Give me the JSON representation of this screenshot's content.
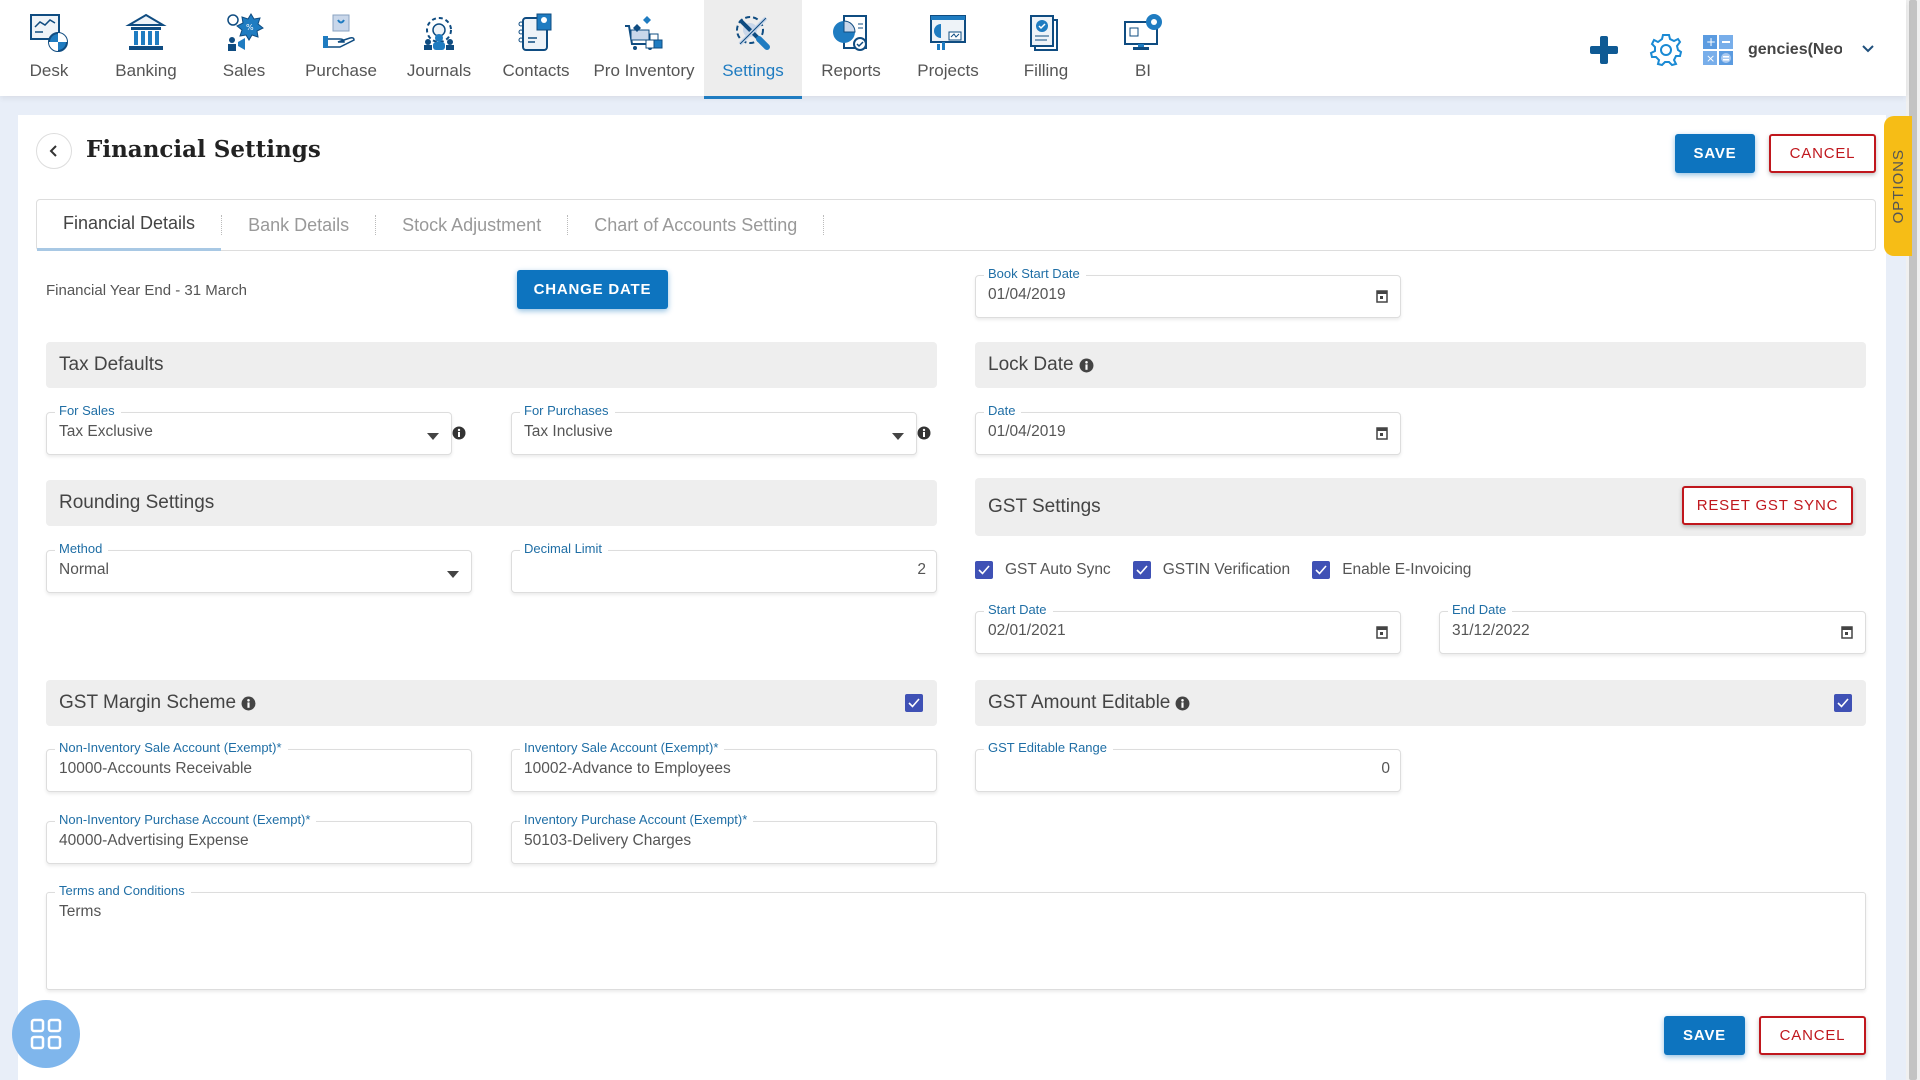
{
  "nav": {
    "items": [
      {
        "label": "Desk",
        "icon": "desk-icon",
        "active": false
      },
      {
        "label": "Banking",
        "icon": "bank-icon",
        "active": false
      },
      {
        "label": "Sales",
        "icon": "sales-icon",
        "active": false
      },
      {
        "label": "Purchase",
        "icon": "purchase-icon",
        "active": false
      },
      {
        "label": "Journals",
        "icon": "journals-icon",
        "active": false
      },
      {
        "label": "Contacts",
        "icon": "contacts-icon",
        "active": false
      },
      {
        "label": "Pro Inventory",
        "icon": "inventory-icon",
        "active": false
      },
      {
        "label": "Settings",
        "icon": "settings-icon",
        "active": true
      },
      {
        "label": "Reports",
        "icon": "reports-icon",
        "active": false
      },
      {
        "label": "Projects",
        "icon": "projects-icon",
        "active": false
      },
      {
        "label": "Filling",
        "icon": "filling-icon",
        "active": false
      },
      {
        "label": "BI",
        "icon": "bi-icon",
        "active": false
      }
    ],
    "company_name": "gencies(Neo l"
  },
  "page": {
    "title": "Financial Settings",
    "save_label": "SAVE",
    "cancel_label": "CANCEL",
    "options_label": "OPTIONS"
  },
  "tabs": [
    {
      "label": "Financial Details",
      "active": true
    },
    {
      "label": "Bank Details",
      "active": false
    },
    {
      "label": "Stock Adjustment",
      "active": false
    },
    {
      "label": "Chart of Accounts Setting",
      "active": false
    }
  ],
  "financial": {
    "year_end_text": "Financial Year End - 31 March",
    "change_date_label": "CHANGE DATE",
    "book_start_label": "Book Start Date",
    "book_start_value": "01/04/2019"
  },
  "tax_defaults": {
    "title": "Tax Defaults",
    "for_sales_label": "For Sales",
    "for_sales_value": "Tax Exclusive",
    "for_purchases_label": "For Purchases",
    "for_purchases_value": "Tax Inclusive"
  },
  "lock_date": {
    "title": "Lock Date",
    "date_label": "Date",
    "date_value": "01/04/2019"
  },
  "rounding": {
    "title": "Rounding Settings",
    "method_label": "Method",
    "method_value": "Normal",
    "decimal_label": "Decimal Limit",
    "decimal_value": "2"
  },
  "gst_settings": {
    "title": "GST Settings",
    "reset_label": "RESET GST SYNC",
    "checkboxes": [
      {
        "label": "GST Auto Sync",
        "checked": true
      },
      {
        "label": "GSTIN Verification",
        "checked": true
      },
      {
        "label": "Enable E-Invoicing",
        "checked": true
      }
    ],
    "start_date_label": "Start Date",
    "start_date_value": "02/01/2021",
    "end_date_label": "End Date",
    "end_date_value": "31/12/2022"
  },
  "gst_margin": {
    "title": "GST Margin Scheme",
    "checked": true,
    "non_inv_sale_label": "Non-Inventory Sale Account (Exempt)*",
    "non_inv_sale_value": "10000-Accounts Receivable",
    "inv_sale_label": "Inventory Sale Account (Exempt)*",
    "inv_sale_value": "10002-Advance to Employees",
    "non_inv_purchase_label": "Non-Inventory Purchase Account (Exempt)*",
    "non_inv_purchase_value": "40000-Advertising Expense",
    "inv_purchase_label": "Inventory Purchase Account (Exempt)*",
    "inv_purchase_value": "50103-Delivery Charges"
  },
  "gst_amount": {
    "title": "GST Amount Editable",
    "checked": true,
    "range_label": "GST Editable Range",
    "range_value": "0"
  },
  "terms": {
    "label": "Terms and Conditions",
    "value": "Terms"
  },
  "colors": {
    "primary": "#0d74bf",
    "danger": "#c0171d",
    "checkbox": "#3f51b5",
    "options_tab": "#f6bd16"
  }
}
